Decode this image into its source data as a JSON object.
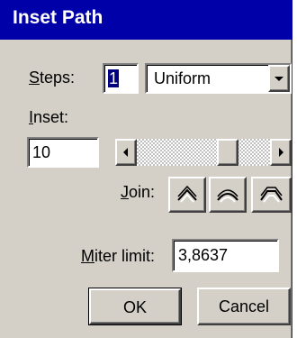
{
  "dialog": {
    "title": "Inset Path"
  },
  "steps": {
    "label": "Steps:",
    "mnemonic": "S",
    "label_rest": "teps:",
    "value": "1",
    "mode": "Uniform"
  },
  "inset": {
    "label_mnemonic": "I",
    "label_rest": "nset:",
    "value": "10",
    "slider_fraction": 0.72
  },
  "join": {
    "label_mnemonic": "J",
    "label_rest": "oin:",
    "options": [
      "miter-join-icon",
      "round-join-icon",
      "bevel-join-icon"
    ]
  },
  "miter": {
    "label_mnemonic": "M",
    "label_rest": "iter limit:",
    "value": "3,8637"
  },
  "buttons": {
    "ok": "OK",
    "cancel": "Cancel"
  }
}
